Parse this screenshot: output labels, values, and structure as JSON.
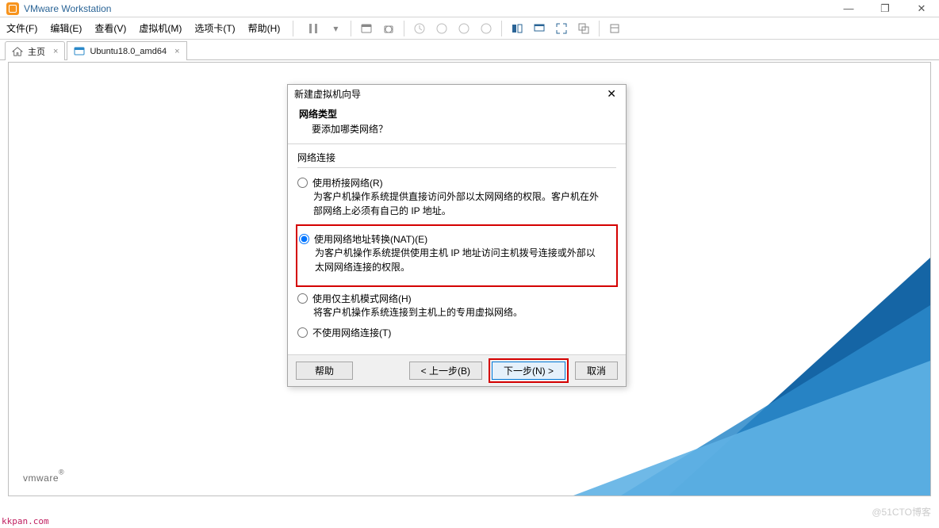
{
  "title_bar": {
    "app_title": "VMware Workstation"
  },
  "menu": {
    "file": "文件(F)",
    "edit": "编辑(E)",
    "view": "查看(V)",
    "vm": "虚拟机(M)",
    "tabs": "选项卡(T)",
    "help": "帮助(H)"
  },
  "tabs": {
    "home": "主页",
    "ubuntu": "Ubuntu18.0_amd64"
  },
  "wizard": {
    "title": "新建虚拟机向导",
    "section_title": "网络类型",
    "section_subtitle": "要添加哪类网络？",
    "group_label": "网络连接",
    "options": {
      "bridged": {
        "label": "使用桥接网络(R)",
        "desc": "为客户机操作系统提供直接访问外部以太网网络的权限。客户机在外部网络上必须有自己的 IP 地址。"
      },
      "nat": {
        "label": "使用网络地址转换(NAT)(E)",
        "desc": "为客户机操作系统提供使用主机 IP 地址访问主机拨号连接或外部以太网网络连接的权限。"
      },
      "hostonly": {
        "label": "使用仅主机模式网络(H)",
        "desc": "将客户机操作系统连接到主机上的专用虚拟网络。"
      },
      "none": {
        "label": "不使用网络连接(T)"
      }
    },
    "buttons": {
      "help": "帮助",
      "back": "< 上一步(B)",
      "next": "下一步(N) >",
      "cancel": "取消"
    }
  },
  "brand": "vmware",
  "footer_url": "kkpan.com",
  "watermark": "@51CTO博客"
}
